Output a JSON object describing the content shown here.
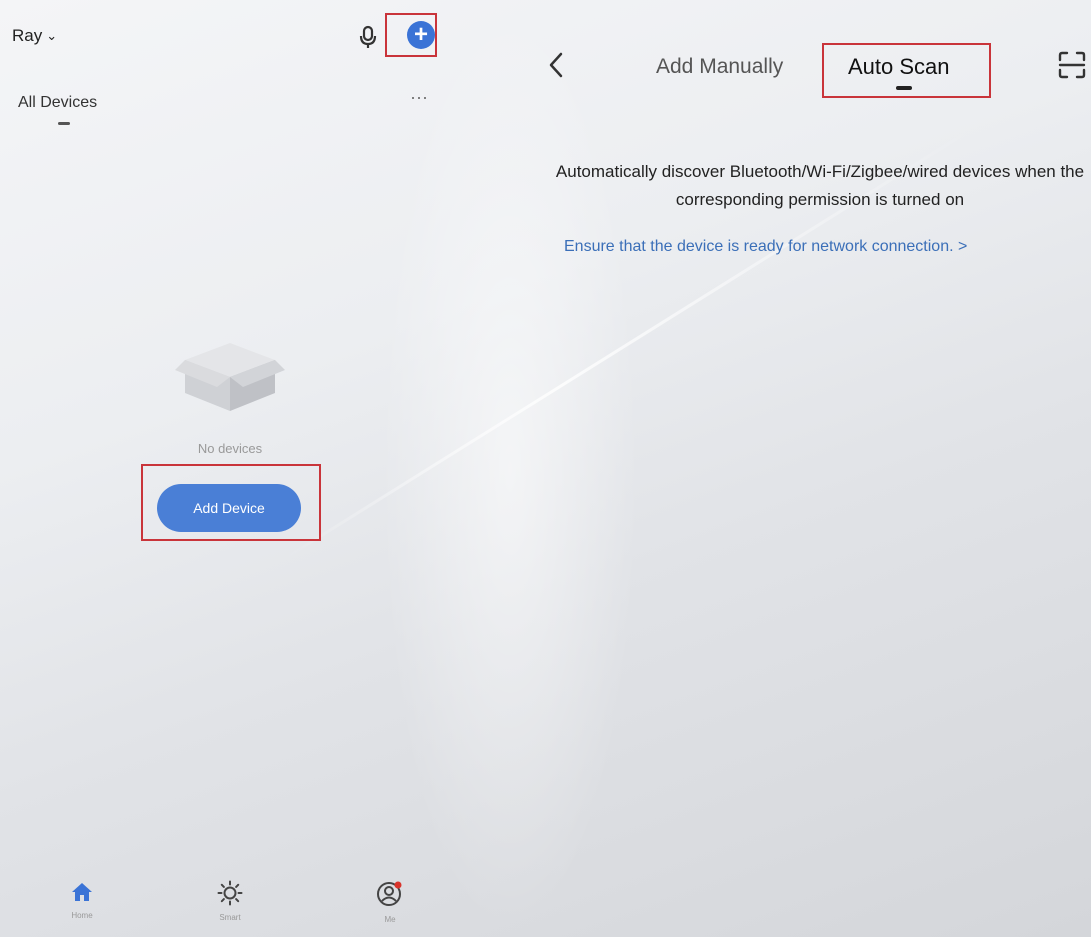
{
  "left_panel": {
    "user_name": "Ray",
    "tab_label": "All Devices",
    "empty_text": "No devices",
    "add_device_label": "Add Device",
    "nav": [
      {
        "label": "Home",
        "icon": "home-icon"
      },
      {
        "label": "Smart",
        "icon": "sun-icon"
      },
      {
        "label": "Me",
        "icon": "profile-icon"
      }
    ]
  },
  "right_panel": {
    "tabs": {
      "manual": "Add Manually",
      "auto": "Auto Scan"
    },
    "description": "Automatically discover Bluetooth/Wi-Fi/Zigbee/wired devices when the corresponding permission is turned on",
    "ensure_link": "Ensure that the device is ready for network connection. >"
  },
  "colors": {
    "accent": "#3a73d6",
    "highlight_box": "#c9343a",
    "link": "#3b6fb8"
  }
}
